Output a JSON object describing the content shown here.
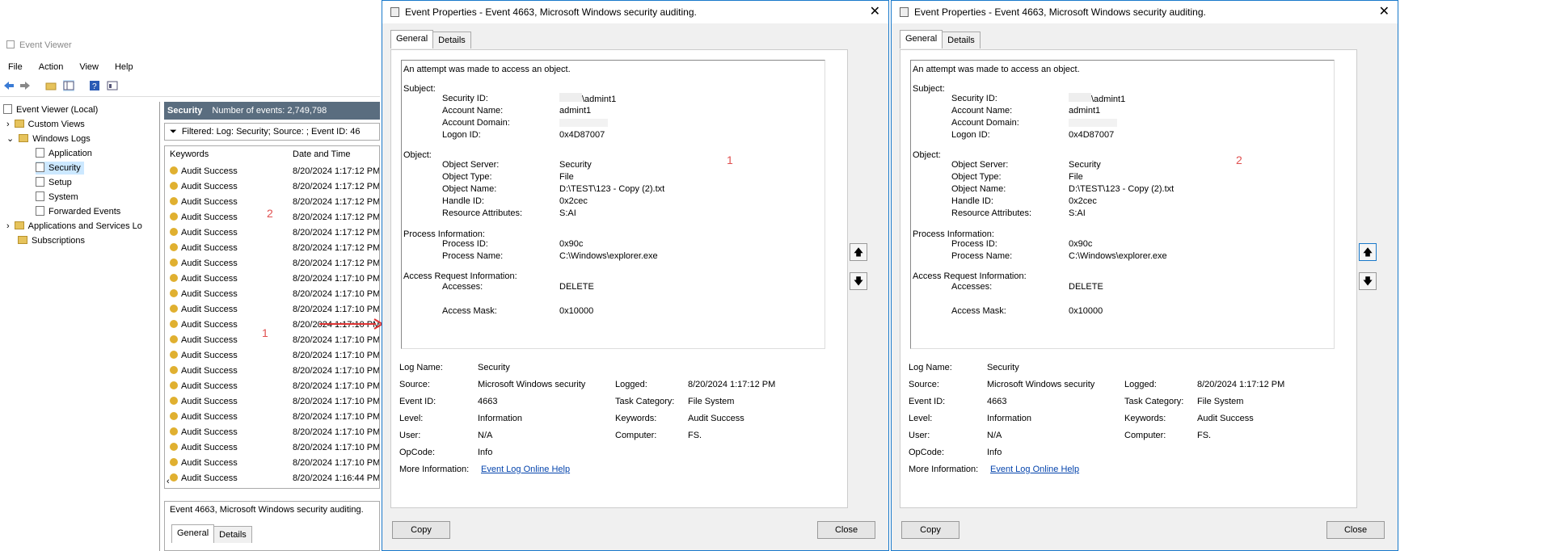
{
  "viewer": {
    "title": "Event Viewer",
    "menu": [
      "File",
      "Action",
      "View",
      "Help"
    ],
    "tree": [
      {
        "label": "Event Viewer (Local)"
      },
      {
        "label": "Custom Views"
      },
      {
        "label": "Windows Logs"
      },
      {
        "label": "Application"
      },
      {
        "label": "Security"
      },
      {
        "label": "Setup"
      },
      {
        "label": "System"
      },
      {
        "label": "Forwarded Events"
      },
      {
        "label": "Applications and Services Lo"
      },
      {
        "label": "Subscriptions"
      }
    ],
    "header_name": "Security",
    "header_count": "Number of events: 2,749,798",
    "filter": "Filtered: Log: Security; Source: ; Event ID: 46",
    "col_keywords": "Keywords",
    "col_date": "Date and Time",
    "rows": [
      {
        "kw": "Audit Success",
        "dt": "8/20/2024 1:17:12 PM"
      },
      {
        "kw": "Audit Success",
        "dt": "8/20/2024 1:17:12 PM"
      },
      {
        "kw": "Audit Success",
        "dt": "8/20/2024 1:17:12 PM"
      },
      {
        "kw": "Audit Success",
        "dt": "8/20/2024 1:17:12 PM"
      },
      {
        "kw": "Audit Success",
        "dt": "8/20/2024 1:17:12 PM"
      },
      {
        "kw": "Audit Success",
        "dt": "8/20/2024 1:17:12 PM"
      },
      {
        "kw": "Audit Success",
        "dt": "8/20/2024 1:17:12 PM"
      },
      {
        "kw": "Audit Success",
        "dt": "8/20/2024 1:17:10 PM"
      },
      {
        "kw": "Audit Success",
        "dt": "8/20/2024 1:17:10 PM"
      },
      {
        "kw": "Audit Success",
        "dt": "8/20/2024 1:17:10 PM"
      },
      {
        "kw": "Audit Success",
        "dt": "8/20/2024 1:17:10 PM"
      },
      {
        "kw": "Audit Success",
        "dt": "8/20/2024 1:17:10 PM"
      },
      {
        "kw": "Audit Success",
        "dt": "8/20/2024 1:17:10 PM"
      },
      {
        "kw": "Audit Success",
        "dt": "8/20/2024 1:17:10 PM"
      },
      {
        "kw": "Audit Success",
        "dt": "8/20/2024 1:17:10 PM"
      },
      {
        "kw": "Audit Success",
        "dt": "8/20/2024 1:17:10 PM"
      },
      {
        "kw": "Audit Success",
        "dt": "8/20/2024 1:17:10 PM"
      },
      {
        "kw": "Audit Success",
        "dt": "8/20/2024 1:17:10 PM"
      },
      {
        "kw": "Audit Success",
        "dt": "8/20/2024 1:17:10 PM"
      },
      {
        "kw": "Audit Success",
        "dt": "8/20/2024 1:17:10 PM"
      },
      {
        "kw": "Audit Success",
        "dt": "8/20/2024 1:16:44 PM"
      }
    ],
    "bottom_title": "Event 4663, Microsoft Windows security auditing.",
    "bottom_tabs": [
      "General",
      "Details"
    ],
    "annot_1": "1",
    "annot_2": "2"
  },
  "dialogs": [
    {
      "title": "Event Properties - Event 4663, Microsoft Windows security auditing.",
      "annot": "1"
    },
    {
      "title": "Event Properties - Event 4663, Microsoft Windows security auditing.",
      "annot": "2"
    }
  ],
  "event": {
    "tabs": [
      "General",
      "Details"
    ],
    "intro": "An attempt was made to access an object.",
    "subject_h": "Subject:",
    "security_id_l": "Security ID:",
    "security_id_v": "\\admint1",
    "account_name_l": "Account Name:",
    "account_name_v": "admint1",
    "account_domain_l": "Account Domain:",
    "logon_id_l": "Logon ID:",
    "logon_id_v": "0x4D87007",
    "object_h": "Object:",
    "object_server_l": "Object Server:",
    "object_server_v": "Security",
    "object_type_l": "Object Type:",
    "object_type_v": "File",
    "object_name_l": "Object Name:",
    "object_name_v": "D:\\TEST\\123 - Copy (2).txt",
    "handle_id_l": "Handle ID:",
    "handle_id_v": "0x2cec",
    "res_attr_l": "Resource Attributes:",
    "res_attr_v": "S:AI",
    "process_h": "Process Information:",
    "process_id_l": "Process ID:",
    "process_id_v": "0x90c",
    "process_name_l": "Process Name:",
    "process_name_v": "C:\\Windows\\explorer.exe",
    "access_h": "Access Request Information:",
    "accesses_l": "Accesses:",
    "accesses_v": "DELETE",
    "mask_l": "Access Mask:",
    "mask_v": "0x10000",
    "log_name_l": "Log Name:",
    "log_name_v": "Security",
    "source_l": "Source:",
    "source_v": "Microsoft Windows security",
    "logged_l": "Logged:",
    "logged_v": "8/20/2024 1:17:12 PM",
    "event_id_l": "Event ID:",
    "event_id_v": "4663",
    "task_l": "Task Category:",
    "task_v": "File System",
    "level_l": "Level:",
    "level_v": "Information",
    "keywords_l": "Keywords:",
    "keywords_v": "Audit Success",
    "user_l": "User:",
    "user_v": "N/A",
    "computer_l": "Computer:",
    "computer_v": "FS.",
    "opcode_l": "OpCode:",
    "opcode_v": "Info",
    "more_l": "More Information:",
    "more_v": "Event Log Online Help",
    "copy": "Copy",
    "close": "Close"
  },
  "colors": {
    "accent": "#1979ca",
    "header": "#5a6d7f",
    "annotation": "#e05050",
    "link": "#0645ad"
  }
}
